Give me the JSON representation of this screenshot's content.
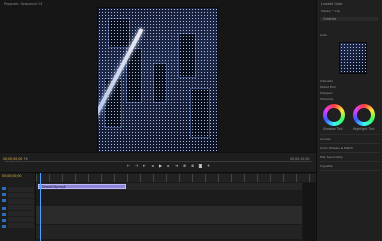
{
  "window": {
    "title": "Untitled_Seq"
  },
  "monitor": {
    "label": "Program: Sequence 01",
    "timecode_left": "00;00;00;00",
    "timecode_right": "00;00;15;00",
    "zoom": "Fit"
  },
  "right_panel": {
    "title": "Lumetri Color",
    "subtitle": "Master * Clip",
    "section": "Creative",
    "look_label": "Look",
    "rows": [
      "Intensity",
      "Faded Film",
      "Sharpen",
      "Vibrance",
      "Saturation"
    ],
    "wheel_labels": [
      "Shadow Tint",
      "Highlight Tint"
    ],
    "sections_below": [
      "Curves",
      "Color Wheels & Match",
      "HSL Secondary",
      "Vignette"
    ]
  },
  "timeline": {
    "clip_label": "DroneCity.mp4",
    "timecode": "00;00;00;00"
  }
}
